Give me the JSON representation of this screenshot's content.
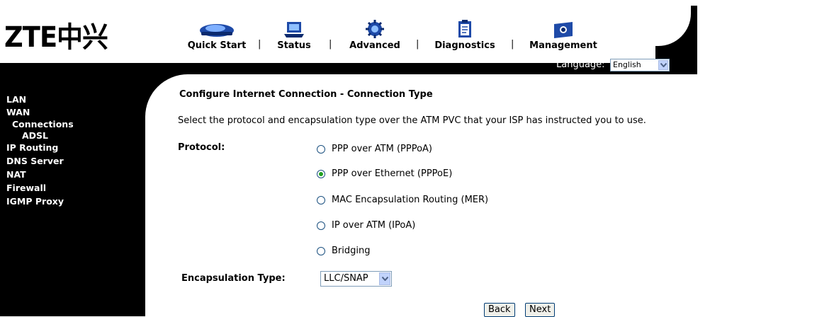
{
  "logo": {
    "text": "ZTE中兴"
  },
  "nav": [
    {
      "label": "Quick Start",
      "icon": "quick-start-icon"
    },
    {
      "label": "Status",
      "icon": "status-icon"
    },
    {
      "label": "Advanced",
      "icon": "advanced-icon"
    },
    {
      "label": "Diagnostics",
      "icon": "diagnostics-icon"
    },
    {
      "label": "Management",
      "icon": "management-icon"
    }
  ],
  "nav_separator": "|",
  "language": {
    "label": "Language:",
    "value": "English"
  },
  "sidebar": {
    "items": [
      "LAN",
      "WAN",
      "Connections",
      "ADSL",
      "IP Routing",
      "DNS Server",
      "NAT",
      "Firewall",
      "IGMP Proxy"
    ]
  },
  "main": {
    "title": "Configure Internet Connection - Connection Type",
    "description": "Select the protocol and encapsulation type over the ATM PVC that your ISP has instructed you to use.",
    "protocol_label": "Protocol:",
    "protocols": [
      {
        "label": "PPP over ATM (PPPoA)",
        "checked": false
      },
      {
        "label": "PPP over Ethernet (PPPoE)",
        "checked": true
      },
      {
        "label": "MAC Encapsulation Routing (MER)",
        "checked": false
      },
      {
        "label": "IP over ATM (IPoA)",
        "checked": false
      },
      {
        "label": "Bridging",
        "checked": false
      }
    ],
    "encapsulation_label": "Encapsulation Type:",
    "encapsulation_value": "LLC/SNAP",
    "back_label": "Back",
    "next_label": "Next"
  },
  "colors": {
    "header": "#000000",
    "radio_selected": "#21a121",
    "link_bg": "#ffffff"
  }
}
